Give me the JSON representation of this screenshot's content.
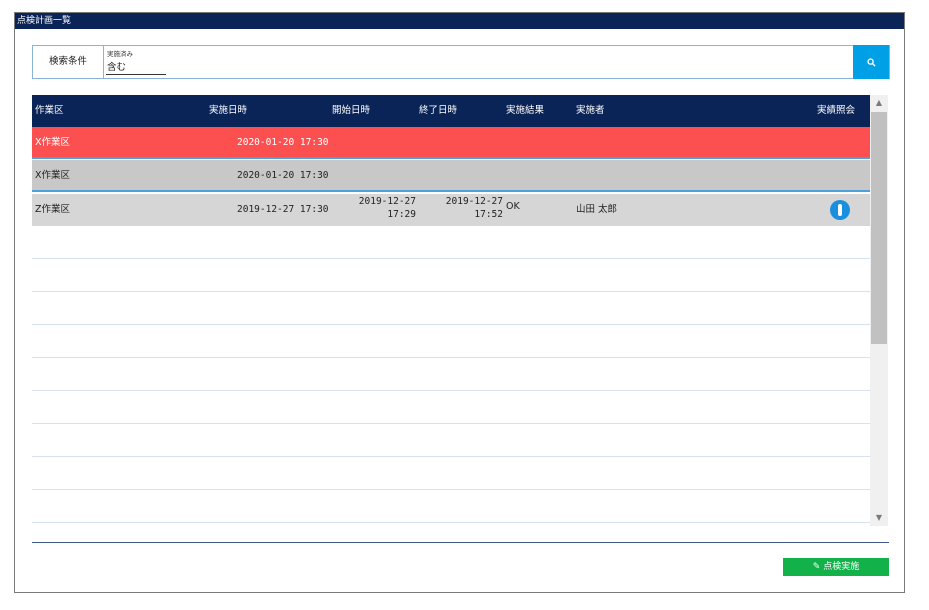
{
  "window": {
    "title": "点検計画一覧"
  },
  "search": {
    "label": "検索条件",
    "field_caption": "実施済み",
    "field_value": "含む",
    "button_icon": "search-icon"
  },
  "grid": {
    "columns": [
      "作業区",
      "実施日時",
      "開始日時",
      "終了日時",
      "実施結果",
      "実施者",
      "実績照会"
    ],
    "rows": [
      {
        "area": "X作業区",
        "scheduled": "2020-01-20 17:30",
        "start_date": "",
        "start_time": "",
        "end_date": "",
        "end_time": "",
        "result": "",
        "operator": "",
        "status": "highlight-red"
      },
      {
        "area": "X作業区",
        "scheduled": "2020-01-20 17:30",
        "start_date": "",
        "start_time": "",
        "end_date": "",
        "end_time": "",
        "result": "",
        "operator": "",
        "status": "selected-gray"
      },
      {
        "area": "Z作業区",
        "scheduled": "2019-12-27 17:30",
        "start_date": "2019-12-27",
        "start_time": "17:29",
        "end_date": "2019-12-27",
        "end_time": "17:52",
        "result": "OK",
        "operator": "山田 太郎",
        "has_detail": true,
        "detail_icon": "info-icon"
      }
    ],
    "empty_rows": 9
  },
  "actions": {
    "inspect_label": "✎ 点検実施"
  },
  "colors": {
    "header_bg": "#0b2458",
    "row_red": "#fc5050",
    "row_gray": "#c8c8c8",
    "row_light": "#d6d6d6",
    "accent_blue": "#00a0e6",
    "action_green": "#12b14a"
  }
}
